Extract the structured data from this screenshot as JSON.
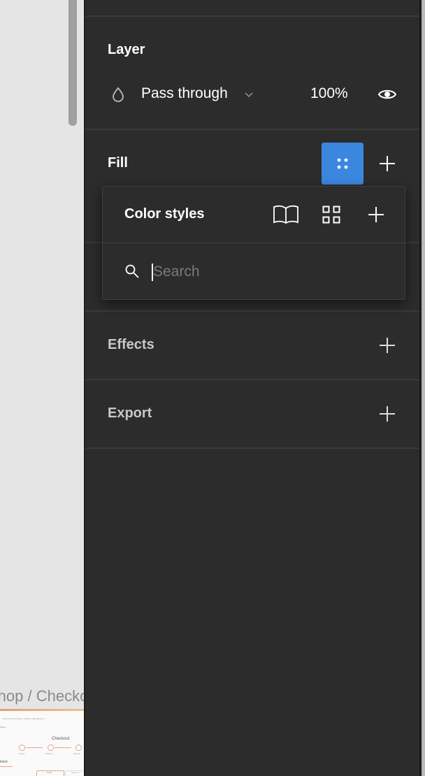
{
  "canvas": {
    "frame_label": "Shop / Checkout",
    "thumbnail": {
      "search_placeholder": "Search by Part Name, Serial #, Manufacturer...",
      "filter_label": "Filters",
      "title": "Checkout",
      "steps": [
        {
          "number": "1",
          "label": "Account"
        },
        {
          "number": "2",
          "label": "Shipping"
        },
        {
          "number": "3",
          "label": "Payment"
        }
      ],
      "section_label": "Payment",
      "buttons": [
        "Card",
        "Apply for"
      ]
    }
  },
  "panel": {
    "layer": {
      "title": "Layer",
      "blend_mode": "Pass through",
      "opacity": "100%",
      "blend_icon": "drop-icon",
      "visibility_icon": "eye-icon"
    },
    "fill": {
      "title": "Fill",
      "styles_button_icon": "style-dots-icon",
      "add_icon": "plus-icon"
    },
    "color_styles_popover": {
      "title": "Color styles",
      "library_icon": "book-icon",
      "view_icon": "grid-icon",
      "add_icon": "plus-icon",
      "search": {
        "value": "",
        "placeholder": "Search"
      }
    },
    "effects": {
      "title": "Effects",
      "add_icon": "plus-icon"
    },
    "export": {
      "title": "Export",
      "add_icon": "plus-icon"
    }
  },
  "colors": {
    "panel_bg": "#2c2c2c",
    "accent": "#3b87e0",
    "canvas_bg": "#e5e5e5"
  }
}
